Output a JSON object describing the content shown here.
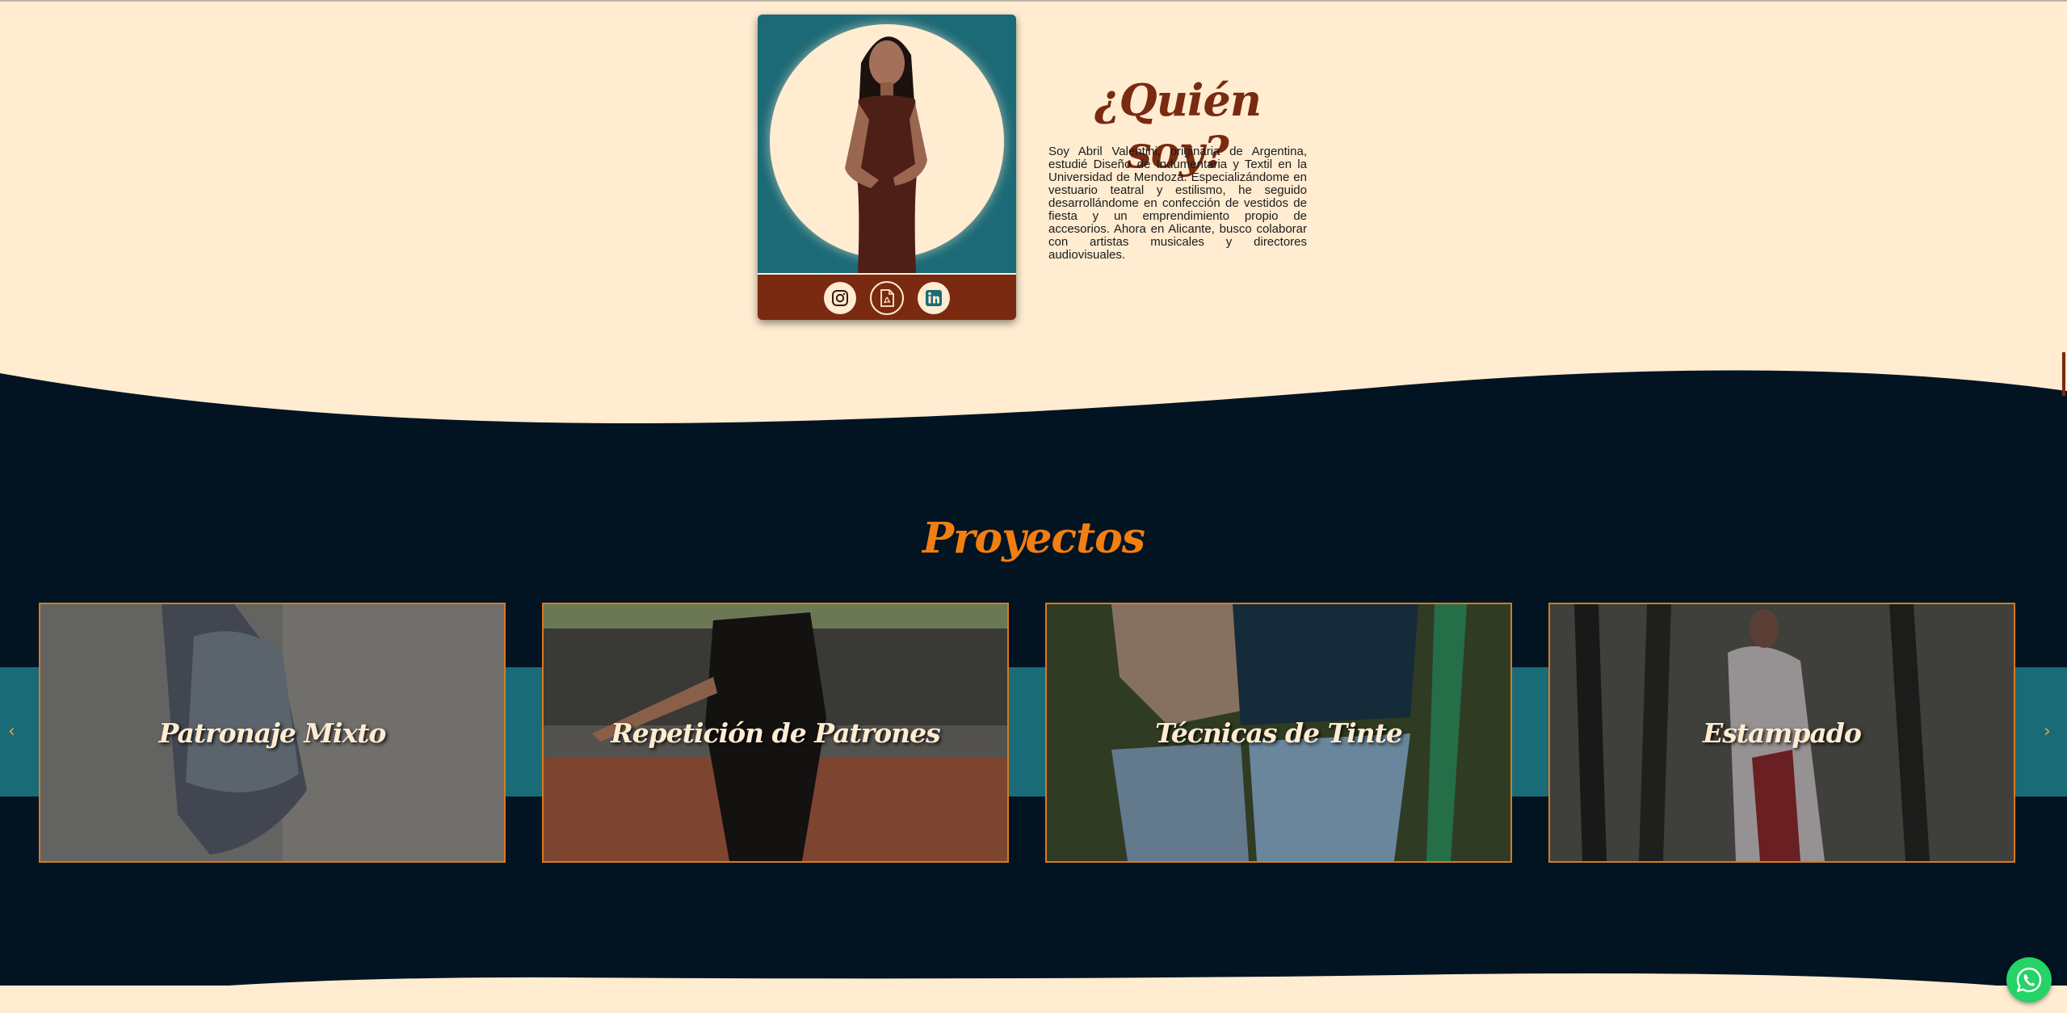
{
  "about": {
    "title": "¿Quién soy?",
    "text": "Soy Abril Valentini, originaria de Argentina, estudié Diseño de Indumentaria y Textil en la Universidad de Mendoza. Especializándome en vestuario teatral y estilismo, he seguido desarrollándome en confección de vestidos de fiesta y un emprendimiento propio de accesorios. Ahora en Alicante, busco colaborar con artistas musicales y directores audiovisuales.",
    "social_icons": [
      "instagram-icon",
      "pdf-file-icon",
      "linkedin-icon"
    ]
  },
  "projects": {
    "title": "Proyectos",
    "items": [
      {
        "label": "Patronaje Mixto"
      },
      {
        "label": "Repetición de Patrones"
      },
      {
        "label": "Técnicas de Tinte"
      },
      {
        "label": "Estampado"
      }
    ],
    "prev_arrow": "‹",
    "next_arrow": "›"
  },
  "colors": {
    "cream": "#ffecd1",
    "navy": "#021421",
    "teal": "#1a6b78",
    "rust": "#7a2a10",
    "orange": "#f27e10",
    "whatsapp": "#25d366"
  }
}
